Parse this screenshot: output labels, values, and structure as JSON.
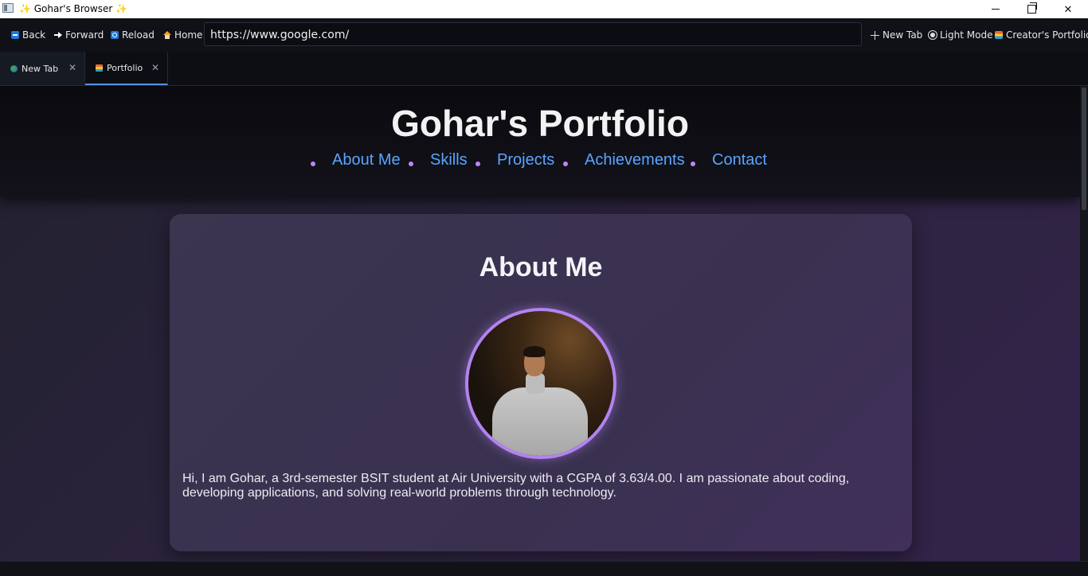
{
  "window": {
    "title": "✨ Gohar's Browser ✨",
    "minimize_icon": "minimize-icon",
    "maximize_icon": "restore-icon",
    "close_glyph": "✕"
  },
  "toolbar": {
    "back_label": "Back",
    "forward_label": "Forward",
    "reload_label": "Reload",
    "home_label": "Home",
    "url": "https://www.google.com/",
    "new_tab_label": "New Tab",
    "light_mode_label": "Light Mode",
    "creator_label": "Creator's Portfolio"
  },
  "tabs": [
    {
      "label": "New Tab",
      "close": "✕",
      "active": false
    },
    {
      "label": "Portfolio",
      "close": "✕",
      "active": true
    }
  ],
  "page": {
    "site_title": "Gohar's Portfolio",
    "nav": [
      "About Me",
      "Skills",
      "Projects",
      "Achievements",
      "Contact"
    ],
    "section_title": "About Me",
    "bio": "Hi, I am Gohar, a 3rd-semester BSIT student at Air University with a CGPA of 3.63/4.00. I am passionate about coding, developing applications, and solving real-world problems through technology.",
    "accent_color": "#58a6ff",
    "avatar_ring_color": "#b383f0"
  }
}
